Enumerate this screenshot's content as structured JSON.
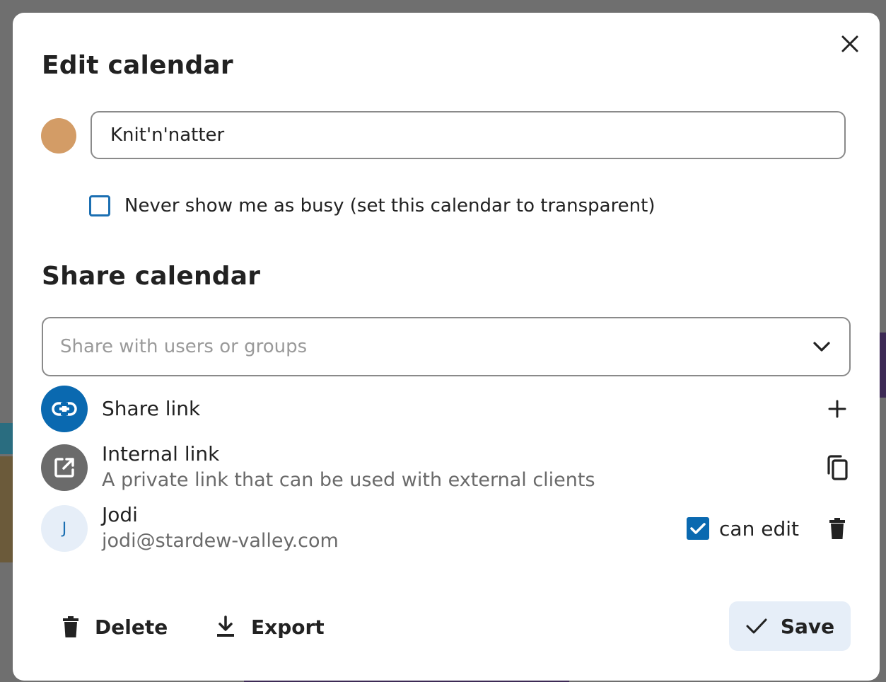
{
  "dialog": {
    "title": "Edit calendar",
    "close_icon": "close-icon"
  },
  "calendar": {
    "color": "#d39c66",
    "name": "Knit'n'natter",
    "transparent_label": "Never show me as busy (set this calendar to transparent)",
    "transparent_checked": false
  },
  "share": {
    "title": "Share calendar",
    "search_placeholder": "Share with users or groups",
    "share_link": {
      "label": "Share link",
      "icon": "link-icon",
      "action_icon": "plus-icon"
    },
    "internal_link": {
      "label": "Internal link",
      "description": "A private link that can be used with external clients",
      "icon": "external-link-icon",
      "action_icon": "copy-icon"
    },
    "users": [
      {
        "initial": "J",
        "name": "Jodi",
        "email": "jodi@stardew-valley.com",
        "can_edit_label": "can edit",
        "can_edit": true
      }
    ]
  },
  "footer": {
    "delete_label": "Delete",
    "export_label": "Export",
    "save_label": "Save"
  },
  "colors": {
    "accent": "#0a69b0",
    "save_bg": "#e6eef8"
  }
}
